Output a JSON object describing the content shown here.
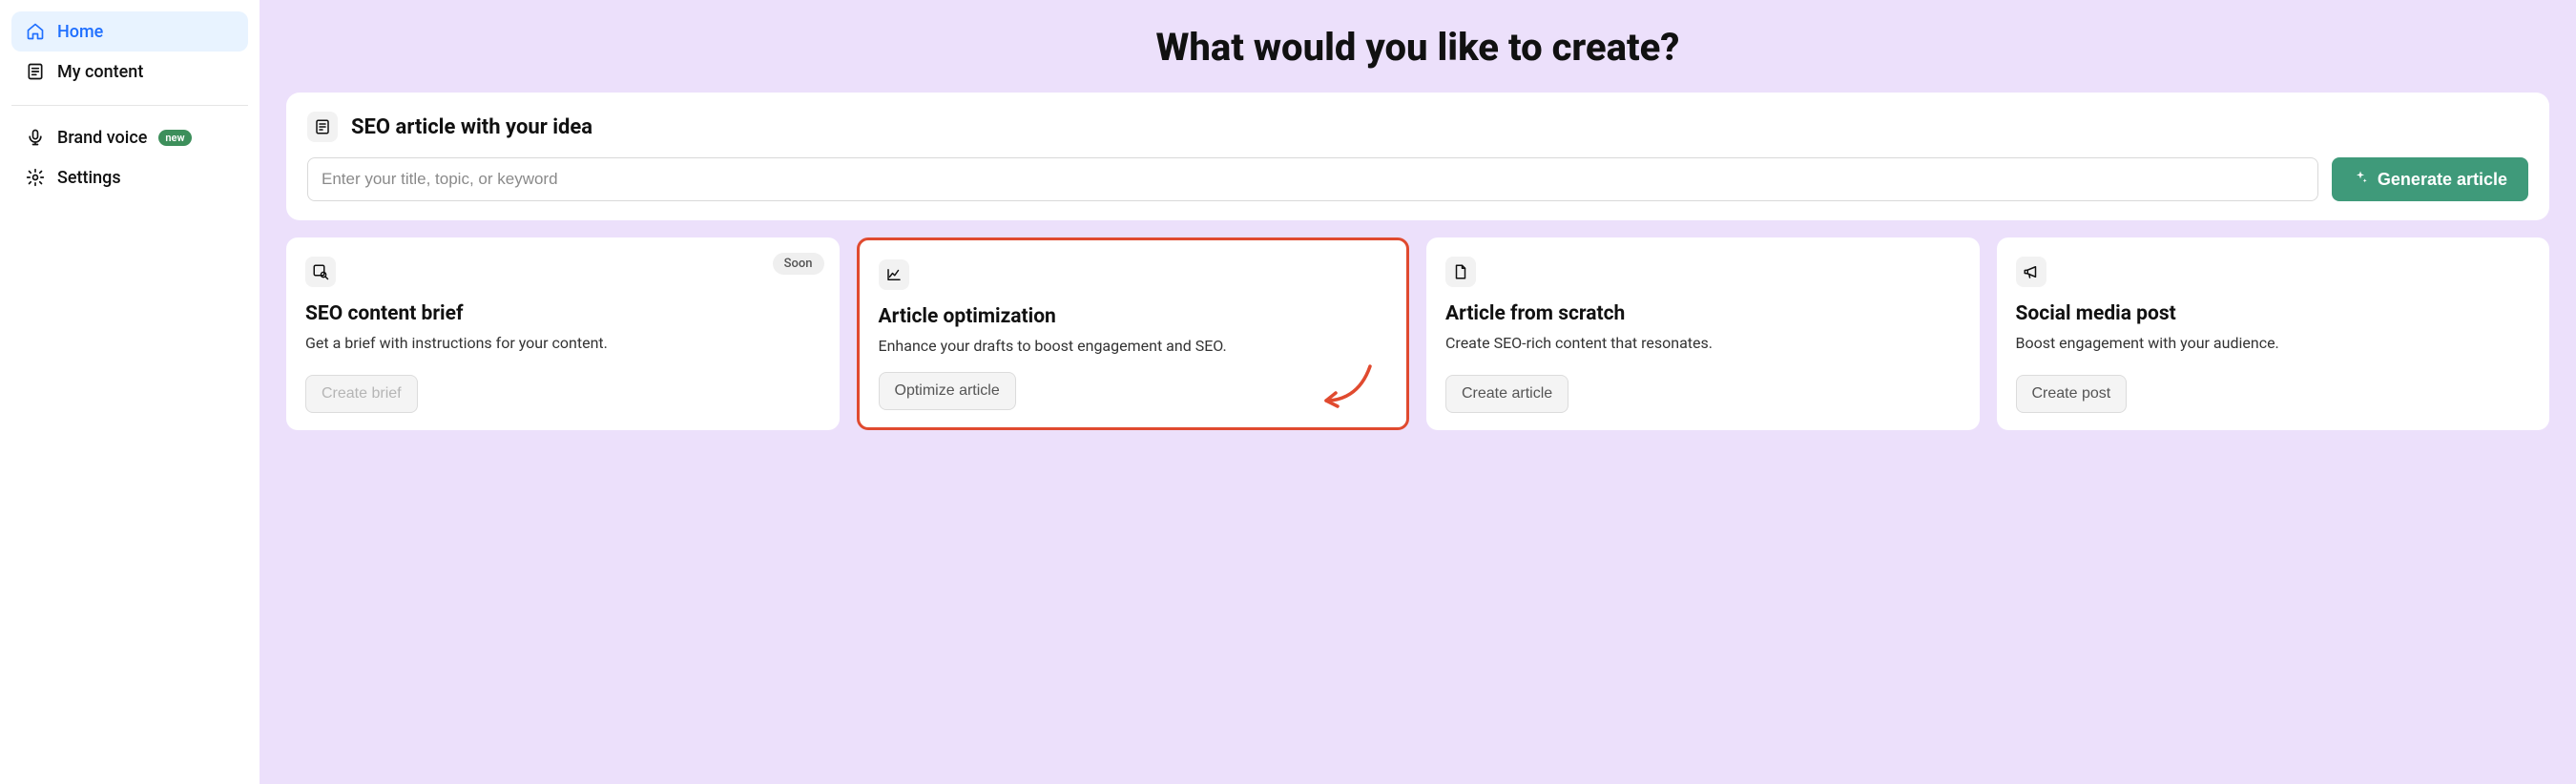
{
  "sidebar": {
    "items": [
      {
        "label": "Home",
        "icon": "home-icon",
        "active": true
      },
      {
        "label": "My content",
        "icon": "document-list-icon",
        "active": false
      },
      {
        "label": "Brand voice",
        "icon": "mic-icon",
        "active": false,
        "badge": "new"
      },
      {
        "label": "Settings",
        "icon": "gear-icon",
        "active": false
      }
    ]
  },
  "main": {
    "title": "What would you like to create?",
    "hero": {
      "icon": "article-icon",
      "title": "SEO article with your idea",
      "placeholder": "Enter your title, topic, or keyword",
      "button": "Generate article"
    },
    "cards": [
      {
        "icon": "search-doc-icon",
        "title": "SEO content brief",
        "desc": "Get a brief with instructions for your content.",
        "button": "Create brief",
        "disabled": true,
        "soon": "Soon",
        "highlight": false
      },
      {
        "icon": "chart-line-icon",
        "title": "Article optimization",
        "desc": "Enhance your drafts to boost engagement and SEO.",
        "button": "Optimize article",
        "disabled": false,
        "highlight": true
      },
      {
        "icon": "file-icon",
        "title": "Article from scratch",
        "desc": "Create SEO-rich content that resonates.",
        "button": "Create article",
        "disabled": false,
        "highlight": false
      },
      {
        "icon": "megaphone-icon",
        "title": "Social media post",
        "desc": "Boost engagement with your audience.",
        "button": "Create post",
        "disabled": false,
        "highlight": false
      }
    ]
  },
  "colors": {
    "accent_blue": "#1f6fff",
    "accent_green": "#3f9a7a",
    "bg_purple": "#ece0fb",
    "highlight_red": "#e04a2f"
  }
}
